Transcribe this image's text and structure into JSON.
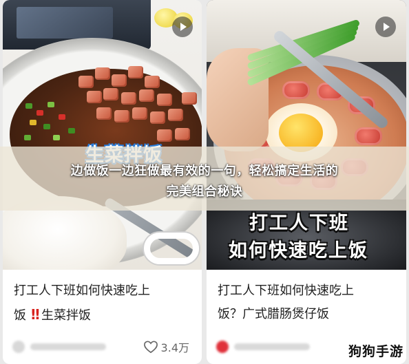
{
  "banner": {
    "line1": "边做饭一边狂做最有效的一句，轻松搞定生活的",
    "line2": "完美组合秘诀"
  },
  "cards": [
    {
      "image_text": "生菜拌饭",
      "title_part1": "打工人下班如何快速吃上",
      "title_prefix": "饭",
      "title_mark": "!!",
      "title_part2": "生菜拌饭",
      "likes": "3.4万",
      "icon": "play-icon"
    },
    {
      "image_text_line1": "打工人下班",
      "image_text_line2": "如何快速吃上饭",
      "title_part1": "打工人下班如何快速吃上",
      "title_part2": "饭？广式腊肠煲仔饭",
      "icon": "play-icon"
    }
  ],
  "watermark": "狗狗手游",
  "colors": {
    "alert": "#d8241f",
    "label_outline": "#2a7bd6",
    "banner_bg": "#ece6d6"
  }
}
